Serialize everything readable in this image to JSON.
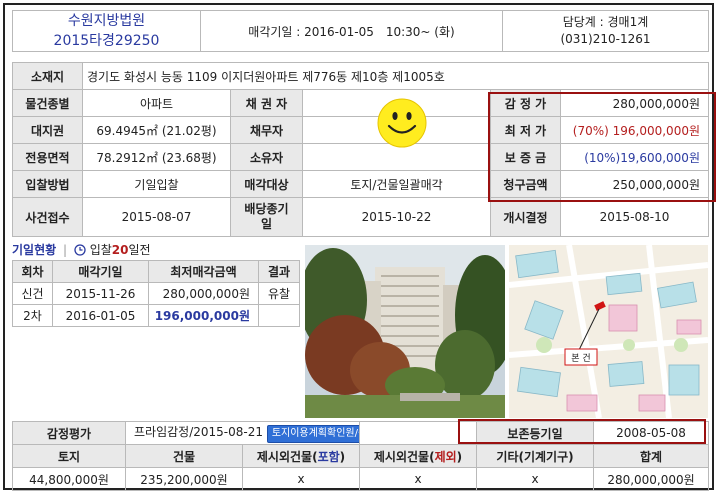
{
  "header": {
    "court": "수원지방법원",
    "case_no": "2015타경29250",
    "auction_date": "매각기일 : 2016-01-05　10:30~ (화)",
    "contact_label": "담당계 : 경매1계",
    "contact_phone": "(031)210-1261"
  },
  "property": {
    "location_label": "소재지",
    "location_value": "경기도 화성시 능동 1109 이지더원아파트 제776동 제10층 제1005호",
    "type_label": "물건종별",
    "type_value": "아파트",
    "creditor_label": "채 권 자",
    "creditor_value": "",
    "appraisal_label": "감 정 가",
    "appraisal_value": "280,000,000원",
    "land_label": "대지권",
    "land_value": "69.4945㎡ (21.02평)",
    "debtor_label": "채무자",
    "debtor_value": "",
    "min_label": "최 저 가",
    "min_value": "(70%)  196,000,000원",
    "area_label": "전용면적",
    "area_value": "78.2912㎡ (23.68평)",
    "owner_label": "소유자",
    "owner_value": "",
    "deposit_label": "보 증 금",
    "deposit_value": "(10%)19,600,000원",
    "bid_method_label": "입찰방법",
    "bid_method_value": "기일입찰",
    "sale_target_label": "매각대상",
    "sale_target_value": "토지/건물일괄매각",
    "claim_label": "청구금액",
    "claim_value": "250,000,000원",
    "receipt_label": "사건접수",
    "receipt_value": "2015-08-07",
    "dividend_label_1": "배당종기",
    "dividend_label_2": "일",
    "dividend_value": "2015-10-22",
    "start_label": "개시결정",
    "start_value": "2015-08-10"
  },
  "history": {
    "title": "기일현황",
    "divider": "|",
    "countdown_prefix": "입찰",
    "countdown_days": "20",
    "countdown_suffix": "일전",
    "columns": [
      "회차",
      "매각기일",
      "최저매각금액",
      "결과"
    ],
    "rows": [
      {
        "round": "신건",
        "date": "2015-11-26",
        "amount": "280,000,000원",
        "result": "유찰"
      },
      {
        "round": "2차",
        "date": "2016-01-05",
        "amount": "196,000,000원",
        "result": ""
      }
    ]
  },
  "map": {
    "marker_label": "본 건"
  },
  "appraisal": {
    "label": "감정평가",
    "value": "프라임감정/2015-08-21",
    "land_use_button": "토지이용계획확인원/공시지가",
    "registry_label": "보존등기일",
    "registry_value": "2008-05-08",
    "columns": [
      "토지",
      "건물",
      "제시외건물(포함)",
      "제시외건물(제외)",
      "기타(기계기구)",
      "합계"
    ],
    "col3_prefix": "제시외건물(",
    "col3_highlight": "포함",
    "col4_prefix": "제시외건물(",
    "col4_highlight": "제외",
    "col_suffix": ")",
    "values": [
      "44,800,000원",
      "235,200,000원",
      "x",
      "x",
      "x",
      "280,000,000원"
    ]
  },
  "colors": {
    "accent_blue": "#2a3aa0",
    "accent_red": "#b41e1e",
    "box_red": "#9a1010",
    "label_gray": "#e9e9e9"
  }
}
